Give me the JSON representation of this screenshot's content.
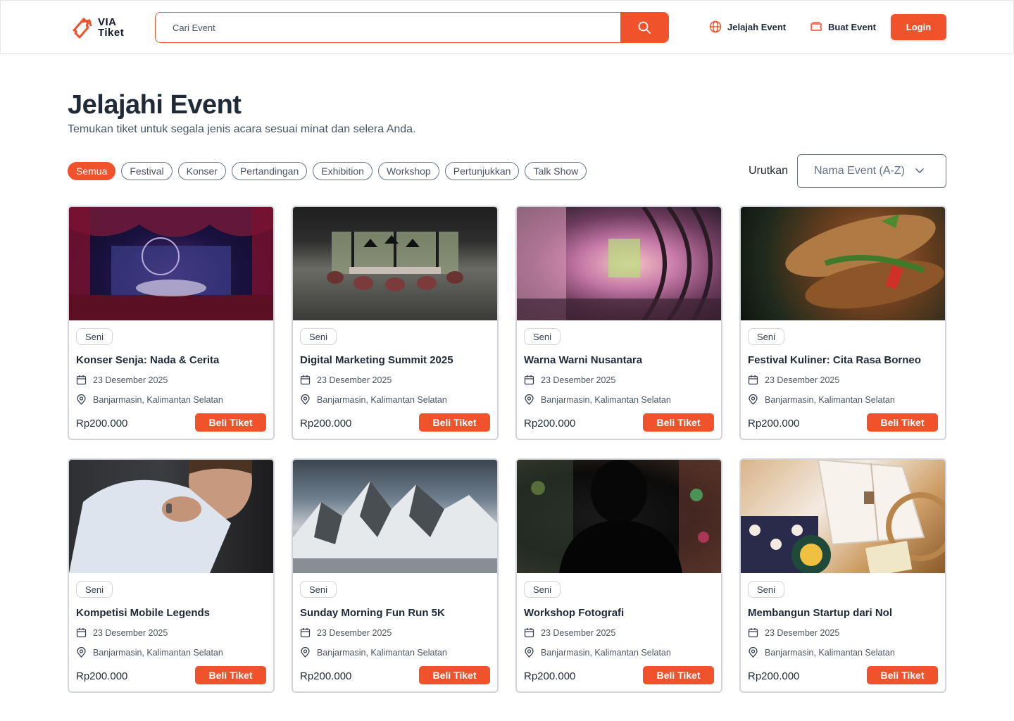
{
  "brand": {
    "line1": "VIA",
    "line2": "Tiket",
    "icon": "ticket-logo-icon",
    "accent": "#f0522b"
  },
  "search": {
    "placeholder": "Cari Event",
    "icon": "search-icon"
  },
  "nav": {
    "explore": {
      "label": "Jelajah Event",
      "icon": "globe-icon"
    },
    "create": {
      "label": "Buat Event",
      "icon": "ticket-icon"
    },
    "login": "Login"
  },
  "page": {
    "title": "Jelajahi Event",
    "subtitle": "Temukan tiket untuk segala jenis acara sesuai minat dan selera Anda."
  },
  "filters": [
    "Semua",
    "Festival",
    "Konser",
    "Pertandingan",
    "Exhibition",
    "Workshop",
    "Pertunjukkan",
    "Talk Show"
  ],
  "active_filter": "Semua",
  "sort": {
    "label": "Urutkan",
    "value": "Nama Event (A-Z)",
    "icon": "chevron-down-icon"
  },
  "events": [
    {
      "category": "Seni",
      "title": "Konser Senja: Nada & Cerita",
      "date": "23 Desember 2025",
      "location": "Banjarmasin, Kalimantan Selatan",
      "price": "Rp200.000",
      "button": "Beli Tiket",
      "image": "theater-stage"
    },
    {
      "category": "Seni",
      "title": "Digital Marketing Summit 2025",
      "date": "23 Desember 2025",
      "location": "Banjarmasin, Kalimantan Selatan",
      "price": "Rp200.000",
      "button": "Beli Tiket",
      "image": "meeting-room"
    },
    {
      "category": "Seni",
      "title": "Warna Warni Nusantara",
      "date": "23 Desember 2025",
      "location": "Banjarmasin, Kalimantan Selatan",
      "price": "Rp200.000",
      "button": "Beli Tiket",
      "image": "colorful-tunnel"
    },
    {
      "category": "Seni",
      "title": "Festival Kuliner: Cita Rasa Borneo",
      "date": "23 Desember 2025",
      "location": "Banjarmasin, Kalimantan Selatan",
      "price": "Rp200.000",
      "button": "Beli Tiket",
      "image": "sandwich"
    },
    {
      "category": "Seni",
      "title": "Kompetisi Mobile Legends",
      "date": "23 Desember 2025",
      "location": "Banjarmasin, Kalimantan Selatan",
      "price": "Rp200.000",
      "button": "Beli Tiket",
      "image": "man-portrait"
    },
    {
      "category": "Seni",
      "title": "Sunday Morning Fun Run 5K",
      "date": "23 Desember 2025",
      "location": "Banjarmasin, Kalimantan Selatan",
      "price": "Rp200.000",
      "button": "Beli Tiket",
      "image": "snowy-mountains"
    },
    {
      "category": "Seni",
      "title": "Workshop Fotografi",
      "date": "23 Desember 2025",
      "location": "Banjarmasin, Kalimantan Selatan",
      "price": "Rp200.000",
      "button": "Beli Tiket",
      "image": "dark-silhouette"
    },
    {
      "category": "Seni",
      "title": "Membangun Startup dari Nol",
      "date": "23 Desember 2025",
      "location": "Banjarmasin, Kalimantan Selatan",
      "price": "Rp200.000",
      "button": "Beli Tiket",
      "image": "book-and-tea"
    }
  ]
}
